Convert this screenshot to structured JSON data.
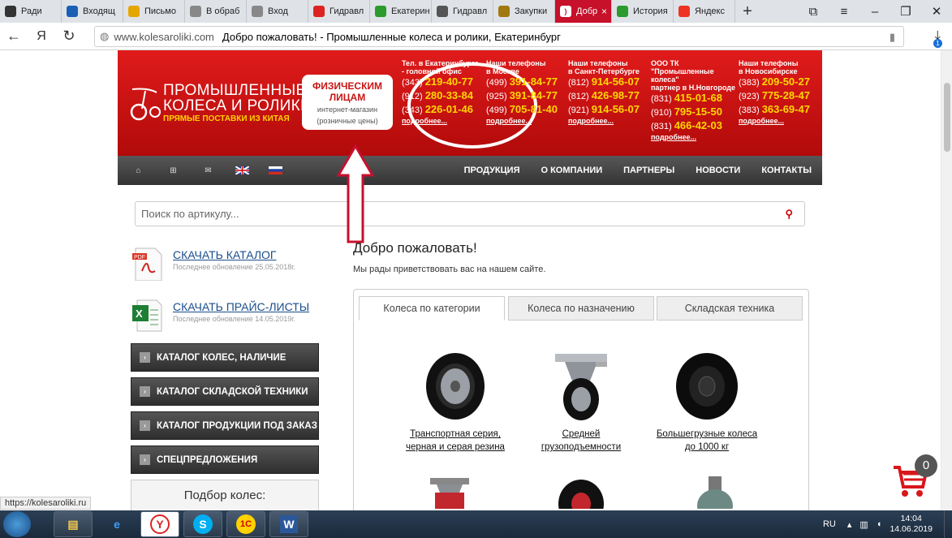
{
  "tabs": [
    {
      "label": "Ради",
      "color": "#333"
    },
    {
      "label": "Входящ",
      "color": "#1a5fb4"
    },
    {
      "label": "Письмо",
      "color": "#e6a600"
    },
    {
      "label": "В обраб",
      "color": "#888"
    },
    {
      "label": "Вход",
      "color": "#888"
    },
    {
      "label": "Гидравл",
      "color": "#d22"
    },
    {
      "label": "Екатерин",
      "color": "#2c9a2c"
    },
    {
      "label": "Гидравл",
      "color": "#555"
    },
    {
      "label": "Закупки",
      "color": "#a07a10"
    },
    {
      "label": "Добр",
      "color": "#c7102a",
      "active": true
    },
    {
      "label": "История",
      "color": "#2c9a2c"
    },
    {
      "label": "Яндекс",
      "color": "#e32"
    }
  ],
  "address": {
    "domain": "www.kolesaroliki.com",
    "title": "Добро пожаловать! - Промышленные колеса и ролики, Екатеринбург",
    "download_count": "1"
  },
  "header": {
    "logo": {
      "line1": "ПРОМЫШЛЕННЫЕ",
      "line2": "КОЛЕСА И РОЛИКИ",
      "line3": "ПРЯМЫЕ ПОСТАВКИ ИЗ КИТАЯ"
    },
    "physical": {
      "title1": "ФИЗИЧЕСКИМ",
      "title2": "ЛИЦАМ",
      "sub1": "интернет-магазин",
      "sub2": "(розничные цены)"
    },
    "phones": [
      {
        "label": "Тел. в Екатеринбурге\n- головной офис",
        "rows": [
          [
            "(343)",
            "219-40-77"
          ],
          [
            "(912)",
            "280-33-84"
          ],
          [
            "(343)",
            "226-01-46"
          ]
        ],
        "more": "подробнее..."
      },
      {
        "label": "Наши телефоны\nв Москве",
        "rows": [
          [
            "(499)",
            "391-84-77"
          ],
          [
            "(925)",
            "391-84-77"
          ],
          [
            "(499)",
            "705-81-40"
          ]
        ],
        "more": "подробнее..."
      },
      {
        "label": "Наши телефоны\nв Санкт-Петербурге",
        "rows": [
          [
            "(812)",
            "914-56-07"
          ],
          [
            "(812)",
            "426-98-77"
          ],
          [
            "(921)",
            "914-56-07"
          ]
        ],
        "more": "подробнее..."
      },
      {
        "label": "ООО ТК\n\"Промышленные\nколеса\"\nпартнер в Н.Новгороде",
        "rows": [
          [
            "(831)",
            "415-01-68"
          ],
          [
            "(910)",
            "795-15-50"
          ],
          [
            "(831)",
            "466-42-03"
          ]
        ],
        "more": "подробнее..."
      },
      {
        "label": "Наши телефоны\nв Новосибирске",
        "rows": [
          [
            "(383)",
            "209-50-27"
          ],
          [
            "(923)",
            "775-28-47"
          ],
          [
            "(383)",
            "363-69-47"
          ]
        ],
        "more": "подробнее..."
      }
    ]
  },
  "nav": {
    "items": [
      "ПРОДУКЦИЯ",
      "О КОМПАНИИ",
      "ПАРТНЕРЫ",
      "НОВОСТИ",
      "КОНТАКТЫ"
    ]
  },
  "search": {
    "placeholder": "Поиск по артикулу..."
  },
  "downloads": [
    {
      "title": "СКАЧАТЬ КАТАЛОГ",
      "date": "Последнее обновление 25.05.2018г."
    },
    {
      "title": "СКАЧАТЬ ПРАЙС-ЛИСТЫ",
      "date": "Последнее обновление 14.05.2019г."
    }
  ],
  "catalog": [
    "КАТАЛОГ КОЛЕС, НАЛИЧИЕ",
    "КАТАЛОГ СКЛАДСКОЙ ТЕХНИКИ",
    "КАТАЛОГ ПРОДУКЦИИ ПОД ЗАКАЗ",
    "СПЕЦПРЕДЛОЖЕНИЯ"
  ],
  "wheel_select": "Подбор колес:",
  "main": {
    "title": "Добро пожаловать!",
    "text": "Мы рады приветствовать вас на нашем сайте.",
    "tabs": [
      "Колеса по категории",
      "Колеса по назначению",
      "Складская техника"
    ],
    "products": [
      {
        "l1": "Транспортная серия,",
        "l2": "черная и серая резина"
      },
      {
        "l1": "Средней",
        "l2": "грузоподъемности"
      },
      {
        "l1": "Большегрузные колеса",
        "l2": "до 1000 кг"
      }
    ]
  },
  "cart": {
    "count": "0"
  },
  "status_url": "https://kolesaroliki.ru",
  "taskbar": {
    "lang": "RU",
    "time": "14:04",
    "date": "14.06.2019"
  }
}
